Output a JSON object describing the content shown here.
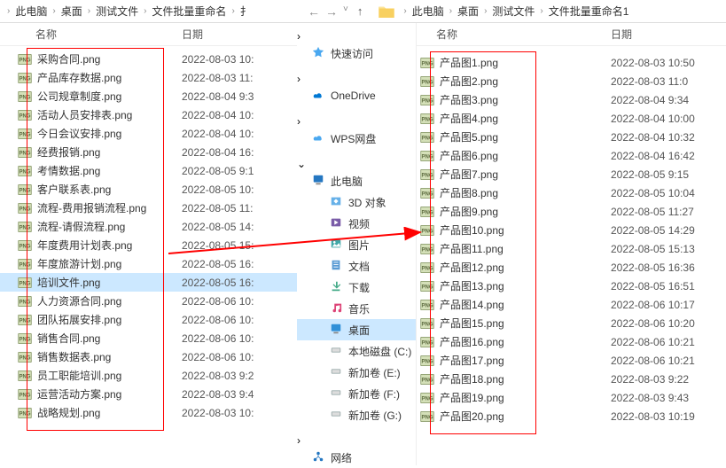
{
  "left": {
    "breadcrumb": [
      "此电脑",
      "桌面",
      "测试文件",
      "文件批量重命名"
    ],
    "headers": {
      "name": "名称",
      "date": "日期"
    },
    "files": [
      {
        "name": "采购合同.png",
        "date": "2022-08-03 10:"
      },
      {
        "name": "产品库存数据.png",
        "date": "2022-08-03 11:"
      },
      {
        "name": "公司规章制度.png",
        "date": "2022-08-04 9:3"
      },
      {
        "name": "活动人员安排表.png",
        "date": "2022-08-04 10:"
      },
      {
        "name": "今日会议安排.png",
        "date": "2022-08-04 10:"
      },
      {
        "name": "经费报销.png",
        "date": "2022-08-04 16:"
      },
      {
        "name": "考情数据.png",
        "date": "2022-08-05 9:1"
      },
      {
        "name": "客户联系表.png",
        "date": "2022-08-05 10:"
      },
      {
        "name": "流程-费用报销流程.png",
        "date": "2022-08-05 11:"
      },
      {
        "name": "流程-请假流程.png",
        "date": "2022-08-05 14:",
        "selected": false
      },
      {
        "name": "年度费用计划表.png",
        "date": "2022-08-05 15:"
      },
      {
        "name": "年度旅游计划.png",
        "date": "2022-08-05 16:"
      },
      {
        "name": "培训文件.png",
        "date": "2022-08-05 16:",
        "selected": true
      },
      {
        "name": "人力资源合同.png",
        "date": "2022-08-06 10:"
      },
      {
        "name": "团队拓展安排.png",
        "date": "2022-08-06 10:"
      },
      {
        "name": "销售合同.png",
        "date": "2022-08-06 10:"
      },
      {
        "name": "销售数据表.png",
        "date": "2022-08-06 10:"
      },
      {
        "name": "员工职能培训.png",
        "date": "2022-08-03 9:2"
      },
      {
        "name": "运营活动方案.png",
        "date": "2022-08-03 9:4"
      },
      {
        "name": "战略规划.png",
        "date": "2022-08-03 10:"
      }
    ]
  },
  "right": {
    "breadcrumb": [
      "此电脑",
      "桌面",
      "测试文件",
      "文件批量重命名1"
    ],
    "headers": {
      "name": "名称",
      "date": "日期"
    },
    "files": [
      {
        "name": "产品图1.png",
        "date": "2022-08-03 10:50"
      },
      {
        "name": "产品图2.png",
        "date": "2022-08-03 11:0"
      },
      {
        "name": "产品图3.png",
        "date": "2022-08-04 9:34"
      },
      {
        "name": "产品图4.png",
        "date": "2022-08-04 10:00"
      },
      {
        "name": "产品图5.png",
        "date": "2022-08-04 10:32"
      },
      {
        "name": "产品图6.png",
        "date": "2022-08-04 16:42"
      },
      {
        "name": "产品图7.png",
        "date": "2022-08-05 9:15"
      },
      {
        "name": "产品图8.png",
        "date": "2022-08-05 10:04"
      },
      {
        "name": "产品图9.png",
        "date": "2022-08-05 11:27"
      },
      {
        "name": "产品图10.png",
        "date": "2022-08-05 14:29"
      },
      {
        "name": "产品图11.png",
        "date": "2022-08-05 15:13"
      },
      {
        "name": "产品图12.png",
        "date": "2022-08-05 16:36"
      },
      {
        "name": "产品图13.png",
        "date": "2022-08-05 16:51"
      },
      {
        "name": "产品图14.png",
        "date": "2022-08-06 10:17"
      },
      {
        "name": "产品图15.png",
        "date": "2022-08-06 10:20"
      },
      {
        "name": "产品图16.png",
        "date": "2022-08-06 10:21"
      },
      {
        "name": "产品图17.png",
        "date": "2022-08-06 10:21"
      },
      {
        "name": "产品图18.png",
        "date": "2022-08-03 9:22"
      },
      {
        "name": "产品图19.png",
        "date": "2022-08-03 9:43"
      },
      {
        "name": "产品图20.png",
        "date": "2022-08-03 10:19"
      }
    ]
  },
  "nav": [
    {
      "label": "快速访问",
      "icon": "star",
      "color": "#4aa8f0",
      "expandable": true
    },
    {
      "label": "OneDrive",
      "icon": "cloud",
      "color": "#0078d4",
      "expandable": true
    },
    {
      "label": "WPS网盘",
      "icon": "cloud2",
      "color": "#4aa8f0",
      "expandable": true
    },
    {
      "label": "此电脑",
      "icon": "pc",
      "color": "#2577c1",
      "expandable": true,
      "expanded": true,
      "children": [
        {
          "label": "3D 对象",
          "icon": "3d"
        },
        {
          "label": "视频",
          "icon": "video"
        },
        {
          "label": "图片",
          "icon": "pic"
        },
        {
          "label": "文档",
          "icon": "doc"
        },
        {
          "label": "下载",
          "icon": "download"
        },
        {
          "label": "音乐",
          "icon": "music"
        },
        {
          "label": "桌面",
          "icon": "desktop",
          "selected": true
        },
        {
          "label": "本地磁盘 (C:)",
          "icon": "drive"
        },
        {
          "label": "新加卷 (E:)",
          "icon": "drive"
        },
        {
          "label": "新加卷 (F:)",
          "icon": "drive"
        },
        {
          "label": "新加卷 (G:)",
          "icon": "drive"
        }
      ]
    },
    {
      "label": "网络",
      "icon": "network",
      "color": "#2577c1",
      "expandable": true
    }
  ]
}
